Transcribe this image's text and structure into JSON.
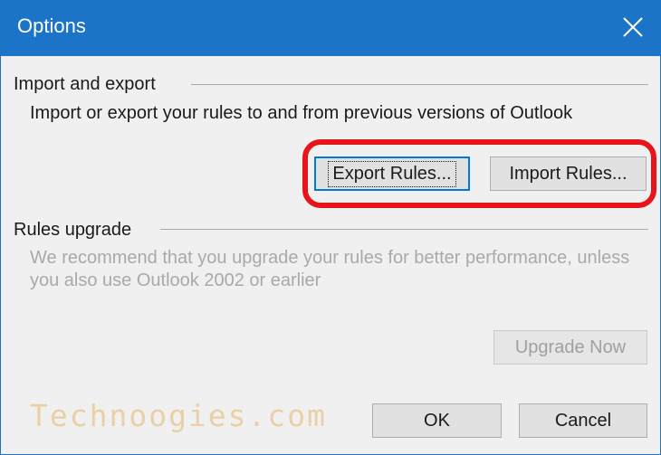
{
  "window": {
    "title": "Options",
    "close_icon": "close-icon"
  },
  "import_export": {
    "group_label": "Import and export",
    "description": "Import or export your rules to and from previous versions of Outlook",
    "export_button": {
      "label": "Export Rules...",
      "accelerator": "E"
    },
    "import_button": {
      "label": "Import Rules...",
      "accelerator": "I"
    }
  },
  "rules_upgrade": {
    "group_label": "Rules upgrade",
    "description": "We recommend that you upgrade your rules for better performance, unless you also use Outlook 2002 or earlier",
    "upgrade_button": {
      "label": "Upgrade Now",
      "accelerator": "U",
      "enabled": false
    }
  },
  "footer": {
    "ok_label": "OK",
    "cancel_label": "Cancel"
  },
  "watermark": "Technoogies.com",
  "colors": {
    "titlebar": "#1c74c8",
    "highlight": "#e8141b",
    "watermark": "#e9d0a6"
  }
}
